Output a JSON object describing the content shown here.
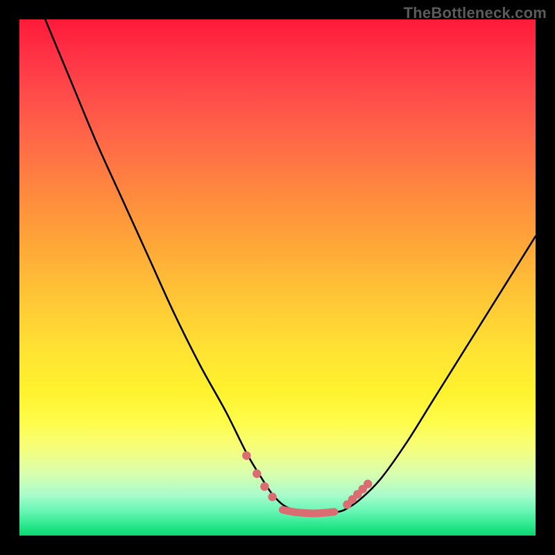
{
  "watermark": "TheBottleneck.com",
  "colors": {
    "background": "#000000",
    "curve_stroke": "#000000",
    "marker_fill": "#d96d72",
    "gradient_top": "#ff1a3a",
    "gradient_bottom": "#0bd56f"
  },
  "chart_data": {
    "type": "line",
    "title": "",
    "xlabel": "",
    "ylabel": "",
    "xlim": [
      0,
      100
    ],
    "ylim": [
      0,
      100
    ],
    "grid": false,
    "legend": false,
    "series": [
      {
        "name": "curve",
        "x": [
          5,
          10,
          15,
          20,
          25,
          30,
          35,
          40,
          44,
          47,
          49,
          51,
          53,
          55,
          57,
          59,
          61,
          63,
          66,
          70,
          75,
          80,
          85,
          90,
          95,
          100
        ],
        "y": [
          100,
          88,
          76,
          65,
          54,
          43,
          33,
          24,
          16,
          11,
          8,
          6,
          5,
          4.5,
          4.3,
          4.3,
          4.5,
          5,
          7,
          11,
          18,
          26,
          34,
          42,
          50,
          58
        ]
      }
    ],
    "markers": [
      {
        "x": 44.0,
        "y": 15.5
      },
      {
        "x": 46.0,
        "y": 12.0
      },
      {
        "x": 47.5,
        "y": 9.5
      },
      {
        "x": 49.0,
        "y": 7.5
      },
      {
        "x": 63.5,
        "y": 6.0
      },
      {
        "x": 64.5,
        "y": 7.0
      },
      {
        "x": 65.5,
        "y": 8.0
      },
      {
        "x": 66.5,
        "y": 9.0
      },
      {
        "x": 67.5,
        "y": 10.0
      }
    ],
    "trough_segment": {
      "x": [
        51,
        53,
        55,
        57,
        59,
        61
      ],
      "y": [
        5.0,
        4.6,
        4.4,
        4.3,
        4.4,
        4.6
      ]
    }
  }
}
